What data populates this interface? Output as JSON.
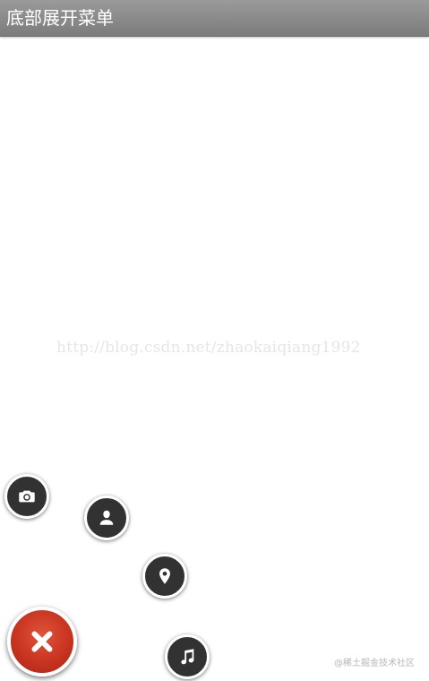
{
  "titlebar": {
    "title": "底部展开菜单"
  },
  "watermark": {
    "text": "http://blog.csdn.net/zhaokaiqiang1992"
  },
  "corner_mark": {
    "text": "@稀土掘金技术社区"
  },
  "menu": {
    "items": [
      {
        "icon": "camera-icon"
      },
      {
        "icon": "person-icon"
      },
      {
        "icon": "location-pin-icon"
      },
      {
        "icon": "music-note-icon"
      }
    ],
    "toggle_icon": "close-icon"
  },
  "colors": {
    "titlebar": "#8a8a8a",
    "menu_button": "#323232",
    "close_button": "#c83420",
    "background": "#ffffff"
  }
}
